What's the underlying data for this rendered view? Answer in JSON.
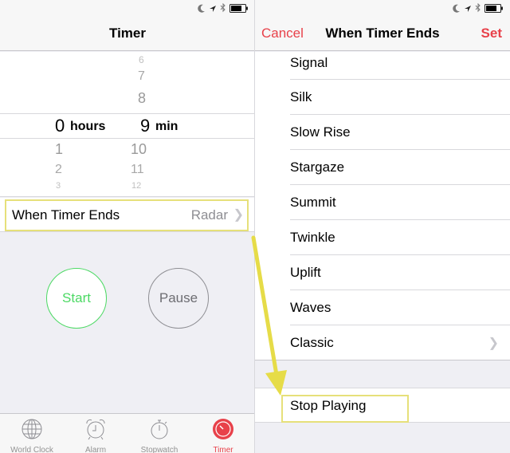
{
  "status_bar": {
    "icons": [
      "moon-icon",
      "location-arrow-icon",
      "bluetooth-icon",
      "battery-icon"
    ]
  },
  "left": {
    "title": "Timer",
    "picker": {
      "hours": {
        "above": [],
        "selected": "0",
        "unit": "hours",
        "below": [
          "1",
          "2",
          "3"
        ]
      },
      "minutes": {
        "above": [
          "6",
          "7",
          "8"
        ],
        "selected": "9",
        "unit": "min",
        "below": [
          "10",
          "11",
          "12"
        ]
      }
    },
    "when_timer_ends": {
      "label": "When Timer Ends",
      "value": "Radar"
    },
    "start_label": "Start",
    "pause_label": "Pause",
    "tabs": [
      {
        "label": "World Clock",
        "icon": "globe-icon",
        "active": false
      },
      {
        "label": "Alarm",
        "icon": "alarm-clock-icon",
        "active": false
      },
      {
        "label": "Stopwatch",
        "icon": "stopwatch-icon",
        "active": false
      },
      {
        "label": "Timer",
        "icon": "timer-icon",
        "active": true
      }
    ]
  },
  "right": {
    "title": "When Timer Ends",
    "cancel_label": "Cancel",
    "set_label": "Set",
    "tones": [
      "Signal",
      "Silk",
      "Slow Rise",
      "Stargaze",
      "Summit",
      "Twinkle",
      "Uplift",
      "Waves",
      "Classic"
    ],
    "stop_playing": "Stop Playing"
  },
  "colors": {
    "accent_red": "#e8414a",
    "start_green": "#4cd964",
    "highlight_yellow": "#e6e07a"
  }
}
